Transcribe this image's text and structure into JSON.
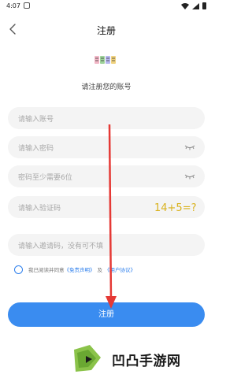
{
  "status_bar": {
    "time": "4:07"
  },
  "header": {
    "title": "注册"
  },
  "logo": {
    "text": "喜喜影视"
  },
  "subtitle": "请注册您的账号",
  "form": {
    "account_placeholder": "请输入账号",
    "password_placeholder": "请输入密码",
    "confirm_placeholder": "密码至少需要6位",
    "captcha_placeholder": "请输入验证码",
    "captcha_text": "14+5=?",
    "invite_placeholder": "请输入邀请码，没有可不填"
  },
  "agreement": {
    "prefix": "我已阅读并同意",
    "disclaimer_link": "《免责声明》",
    "and": "及",
    "user_agreement_link": "《用户协议》"
  },
  "register_button": {
    "label": "注册"
  },
  "watermark": {
    "text": "凹凸手游网"
  },
  "colors": {
    "accent": "#3a8cf0",
    "annotation_arrow": "#e53935",
    "field_bg": "#f4f4f4"
  }
}
